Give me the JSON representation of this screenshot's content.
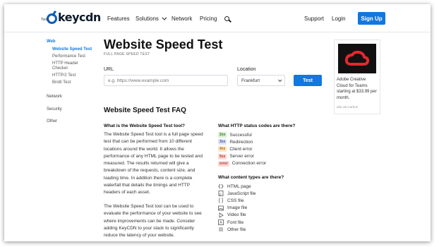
{
  "header": {
    "logo_text": "keycdn",
    "logo_sub": "Tools",
    "nav": {
      "features": "Features",
      "solutions": "Solutions",
      "network": "Network",
      "pricing": "Pricing"
    },
    "support": "Support",
    "login": "Login",
    "signup": "Sign Up"
  },
  "sidebar": {
    "web": "Web",
    "web_items": [
      "Website Speed Test",
      "Performance Test",
      "HTTP Header",
      "Checker",
      "HTTP/2 Test",
      "Brotli Test"
    ],
    "network": "Network",
    "security": "Security",
    "other": "Other"
  },
  "main": {
    "title": "Website Speed Test",
    "subtitle": "FULL PAGE SPEED TEST",
    "url_label": "URL",
    "url_placeholder": "e.g. https://www.example.com",
    "location_label": "Location",
    "location_value": "Frankfurt",
    "test_button": "Test",
    "faq_title": "Website Speed Test FAQ",
    "q1": "What is the Website Speed Test tool?",
    "p1_lines": [
      "The Website Speed Test tool is a full page speed",
      "test that can be performed from 10 different",
      "locations around the world. It allows the",
      "performance of any HTML page to be tested and",
      "measured. The results returned will give a",
      "breakdown of the requests, content size, and",
      "loading time. In addition there is a complete",
      "waterfall that details the timings and HTTP",
      "headers of each asset."
    ],
    "p2_lines": [
      "The Website Speed Test tool can be used to",
      "evaluate the performance of your website to see",
      "where improvements can be made. Consider",
      "adding KeyCDN to your stack to significantly",
      "reduce the latency of your website."
    ],
    "q2": "What HTTP status codes are there?",
    "status_codes": [
      {
        "code": "2xx",
        "label": "Successful",
        "bg": "#d8f0d3",
        "fg": "#2f7a25"
      },
      {
        "code": "3xx",
        "label": "Redirection",
        "bg": "#dde4f7",
        "fg": "#3a55a6"
      },
      {
        "code": "4xx",
        "label": "Client error",
        "bg": "#fbe6c8",
        "fg": "#a86a12"
      },
      {
        "code": "5xx",
        "label": "Server error",
        "bg": "#fbd8d4",
        "fg": "#b23a2f"
      },
      {
        "code": "error",
        "label": "Connection error",
        "bg": "#fbd8d4",
        "fg": "#b23a2f"
      }
    ],
    "q3": "What content types are there?",
    "content_types": [
      {
        "icon": "code-icon",
        "label": "HTML page"
      },
      {
        "icon": "js-file-icon",
        "label": "JavaScript file"
      },
      {
        "icon": "braces-icon",
        "label": "CSS file"
      },
      {
        "icon": "image-icon",
        "label": "Image file"
      },
      {
        "icon": "play-icon",
        "label": "Video file"
      },
      {
        "icon": "font-icon",
        "label": "Font file"
      },
      {
        "icon": "lines-icon",
        "label": "Other file"
      }
    ]
  },
  "ad": {
    "text": "Adobe Creative Cloud for Teams starting at $33.99 per month.",
    "text_lines": [
      "Adobe Creative",
      "Cloud for Teams",
      "starting at $33.99 per",
      "month."
    ],
    "via": "ads via Carbon"
  },
  "colors": {
    "accent": "#1476df",
    "logo": "#0a5ebd",
    "adobe_red": "#e4282d"
  }
}
